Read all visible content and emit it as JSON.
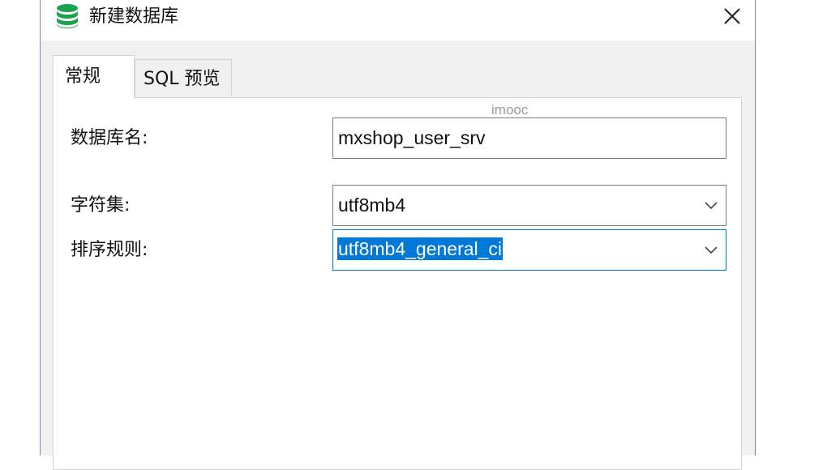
{
  "window": {
    "title": "新建数据库"
  },
  "tabs": [
    {
      "label": "常规",
      "active": true
    },
    {
      "label": "SQL 预览",
      "active": false
    }
  ],
  "watermark": "imooc",
  "form": {
    "db_name_label": "数据库名:",
    "db_name_value": "mxshop_user_srv",
    "charset_label": "字符集:",
    "charset_value": "utf8mb4",
    "collation_label": "排序规则:",
    "collation_value": "utf8mb4_general_ci"
  },
  "icons": {
    "title": "database-icon",
    "close": "close-icon",
    "dropdown": "chevron-down-icon"
  },
  "colors": {
    "accent": "#0078d7",
    "title_icon": "#1aa34a"
  }
}
